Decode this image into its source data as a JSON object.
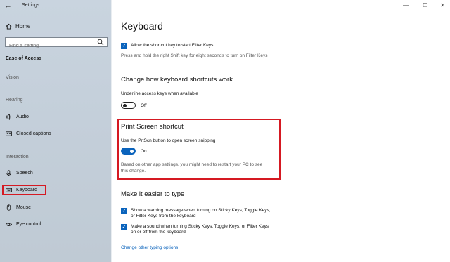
{
  "window": {
    "title": "Settings",
    "controls": {
      "minimize": "—",
      "maximize": "☐",
      "close": "✕"
    }
  },
  "sidebar": {
    "back_icon": "back-arrow-icon",
    "home_label": "Home",
    "search_placeholder": "Find a setting",
    "section_title": "Ease of Access",
    "groups": {
      "vision": "Vision",
      "hearing": "Hearing",
      "interaction": "Interaction"
    },
    "items": {
      "audio": "Audio",
      "closed_captions": "Closed captions",
      "speech": "Speech",
      "keyboard": "Keyboard",
      "mouse": "Mouse",
      "eye_control": "Eye control"
    },
    "selected_item": "Keyboard"
  },
  "main": {
    "title": "Keyboard",
    "filter_keys": {
      "label": "Allow the shortcut key to start Filter Keys",
      "checked": true,
      "description": "Press and hold the right Shift key for eight seconds to turn on Filter Keys"
    },
    "shortcuts": {
      "heading": "Change how keyboard shortcuts work",
      "underline_label": "Underline access keys when available",
      "underline_state": "Off"
    },
    "print_screen": {
      "heading": "Print Screen shortcut",
      "label": "Use the PrtScn button to open screen snipping",
      "state": "On",
      "note_line1": "Based on other app settings, you might need to restart your PC to see",
      "note_line2": "this change."
    },
    "typing": {
      "heading": "Make it easier to type",
      "warning_line1": "Show a warning message when turning on Sticky Keys, Toggle Keys,",
      "warning_line2": "or Filter Keys from the keyboard",
      "sound_line1": "Make a sound when turning Sticky Keys, Toggle Keys, or Filter Keys",
      "sound_line2": "on or off from the keyboard",
      "link": "Change other typing options"
    }
  },
  "colors": {
    "accent": "#0a63bc",
    "highlight": "#d51922",
    "sidebar_bg": "#c4cfda"
  }
}
